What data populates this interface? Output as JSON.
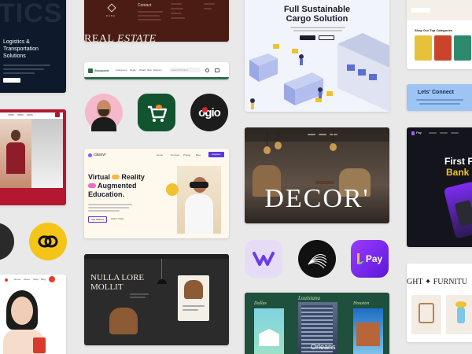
{
  "colors": {
    "bg": "#e9e9e9",
    "navy": "#0e1a2b",
    "maroon": "#4a1c14",
    "green": "#1f4f3d",
    "red": "#b41731",
    "yellow": "#f4c518",
    "purple": "#7b2cf0",
    "lavender": "#e7dcf5",
    "pink": "#f5b9cb",
    "gold": "#c7a44e"
  },
  "logistics": {
    "bg_word": "TICS",
    "title": "Logistics & Transportation Solutions"
  },
  "real_estate": {
    "contact_label": "Contact",
    "logo_word": "KASA",
    "title_a": "REAL ",
    "title_b": "ESTATE"
  },
  "shop": {
    "brand": "Shopcard",
    "links": [
      "Categories",
      "Deals",
      "What's New",
      "Delivery"
    ],
    "search_placeholder": "Search Product"
  },
  "cargo": {
    "title_line1": "Full Sustainable",
    "title_line2": "Cargo Solution"
  },
  "categories": {
    "title": "Shop Our Top Categories"
  },
  "connect": {
    "title": "Lets' Connect"
  },
  "education": {
    "logo": "classvr",
    "nav": [
      "Home",
      "Courses",
      "Pricing",
      "Blog"
    ],
    "cta": "Register",
    "title_a": "Virtual ",
    "title_b": "Reality",
    "title_c": "Augmented",
    "title_d": "Education.",
    "btn_primary": "Get Started",
    "btn_secondary": "Watch Video"
  },
  "decor": {
    "word": "DECOR'"
  },
  "bank": {
    "brand": "Pay",
    "title_line1": "First Fu",
    "title_line2": "Bank"
  },
  "pay_icon": {
    "label": "Pay"
  },
  "chair_card": {
    "title_line1": "NULLA LORE",
    "title_line2": "MOLLIT"
  },
  "architecture": {
    "city1": "Dallas",
    "city2": "Louisiana",
    "city3": "Houston",
    "city4": "Orleans"
  },
  "furniture": {
    "title": "GHT ✦ FURNITU"
  },
  "logo_ogio": {
    "text": "ogio"
  },
  "portrait_nav": {
    "items": [
      "Home",
      "About",
      "Shop",
      "Blog"
    ]
  }
}
